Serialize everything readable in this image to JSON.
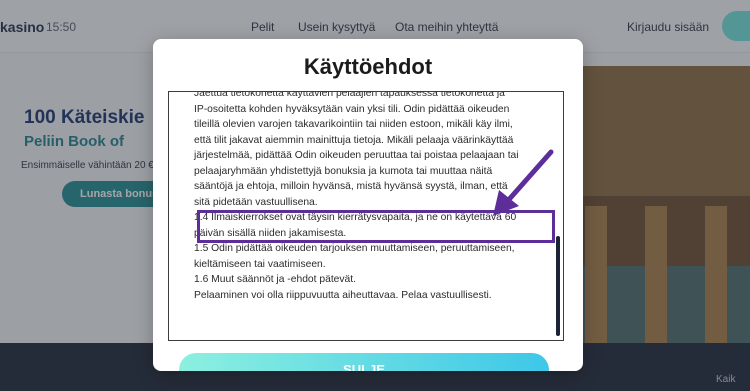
{
  "header": {
    "logo": "kasino",
    "clock": "15:50",
    "nav": [
      "Pelit",
      "Usein kysyttyä",
      "Ota meihin yhteyttä"
    ],
    "login": "Kirjaudu sisään"
  },
  "hero": {
    "title": "100 Käteiskie",
    "subtitle": "Peliin Book of",
    "small": "Ensimmäiselle vähintään 20 €",
    "cta": "Lunasta bonusl"
  },
  "footer": {
    "right_text": "Kaik"
  },
  "modal": {
    "title": "Käyttöehdot",
    "lines": [
      "Jaettua tietokonetta käyttävien pelaajien tapauksessa tietokonetta ja",
      "IP-osoitetta kohden hyväksytään vain yksi tili. Odin pidättää oikeuden",
      "tileillä olevien varojen takavarikointiin tai niiden estoon, mikäli käy ilmi,",
      "että tilit jakavat aiemmin mainittuja tietoja. Mikäli pelaaja väärinkäyttää",
      "järjestelmää, pidättää Odin oikeuden peruuttaa tai poistaa pelaajaan tai",
      "pelaajaryhmään yhdistettyjä bonuksia ja kumota tai muuttaa näitä",
      "sääntöjä ja ehtoja, milloin hyvänsä, mistä hyvänsä syystä, ilman, että",
      "sitä pidetään vastuullisena.",
      "1.4 Ilmaiskierrokset ovat täysin kierrätysvapaita, ja ne on käytettävä 60",
      "päivän sisällä niiden jakamisesta.",
      "1.5 Odin pidättää oikeuden tarjouksen muuttamiseen, peruuttamiseen,",
      "kieltämiseen tai vaatimiseen.",
      "1.6 Muut säännöt ja -ehdot pätevät.",
      "Pelaaminen voi olla riippuvuutta aiheuttavaa. Pelaa vastuullisesti."
    ],
    "close_label": "SULJE"
  },
  "colors": {
    "highlight": "#5d2d9a",
    "button_gradient_start": "#8cf0df",
    "button_gradient_end": "#3ec7e8"
  }
}
